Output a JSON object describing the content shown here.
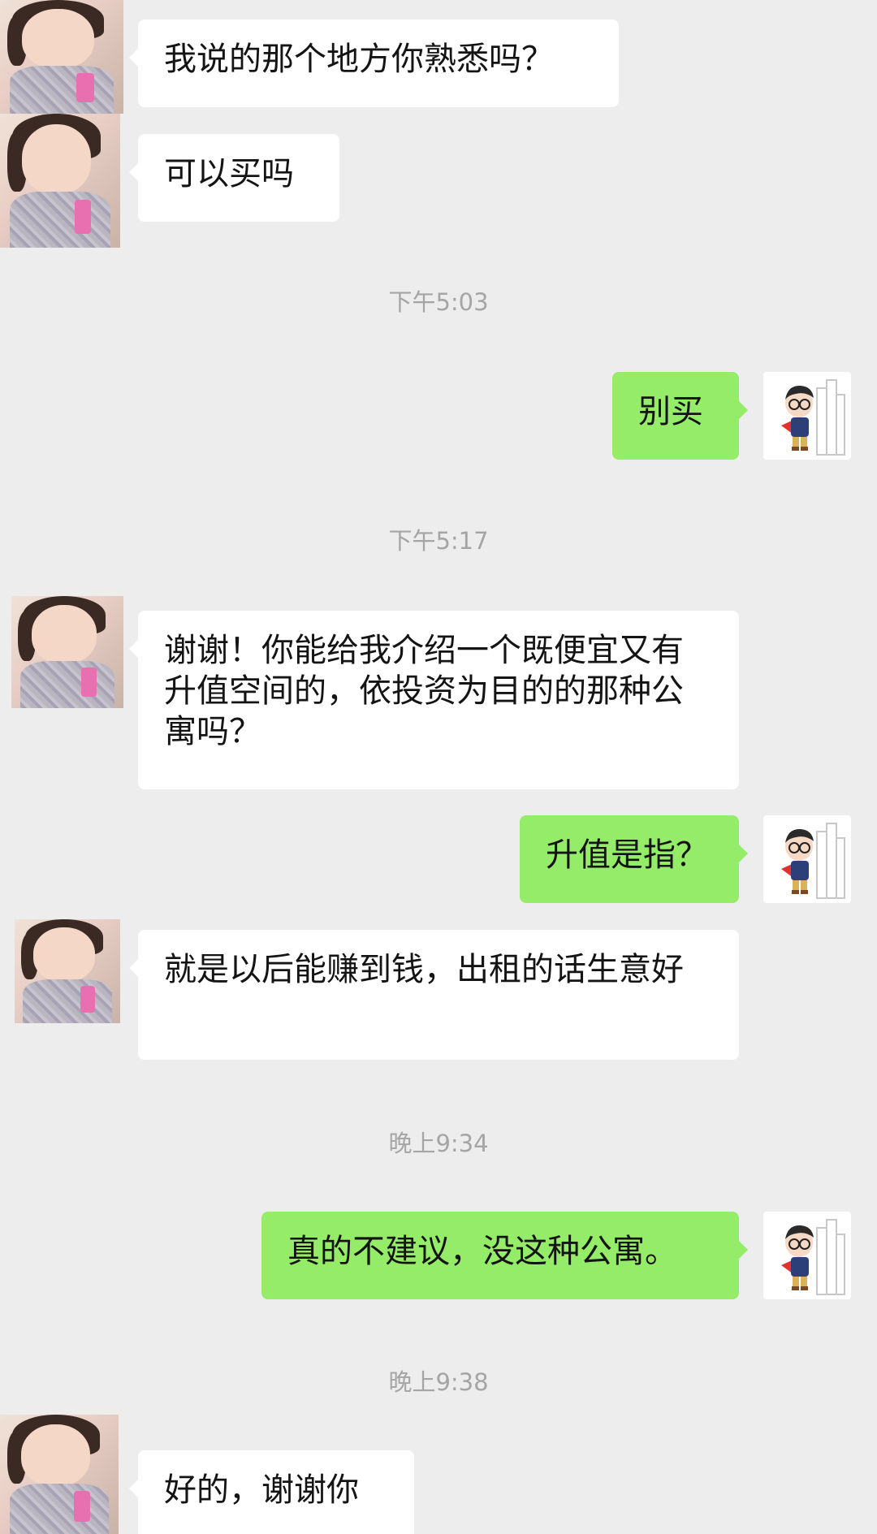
{
  "conversation": {
    "messages": [
      {
        "sender": "contact",
        "text": "我说的那个地方你熟悉吗？"
      },
      {
        "sender": "contact",
        "text": "可以买吗"
      },
      {
        "sender": "me",
        "text": "别买"
      },
      {
        "sender": "contact",
        "text": "谢谢！你能给我介绍一个既便宜又有升值空间的，依投资为目的的那种公寓吗？"
      },
      {
        "sender": "me",
        "text": "升值是指？"
      },
      {
        "sender": "contact",
        "text": "就是以后能赚到钱，出租的话生意好"
      },
      {
        "sender": "me",
        "text": "真的不建议，没这种公寓。"
      },
      {
        "sender": "contact",
        "text": "好的，谢谢你"
      }
    ],
    "timestamps": [
      "下午5:03",
      "下午5:17",
      "晚上9:34",
      "晚上9:38"
    ]
  },
  "colors": {
    "background": "#ededed",
    "incoming_bubble": "#ffffff",
    "outgoing_bubble": "#95ec69",
    "timestamp_text": "#a5a5a5"
  },
  "icons": {
    "contact_avatar": "girl-photo-avatar",
    "my_avatar": "cartoon-superhero-buildings-avatar"
  }
}
